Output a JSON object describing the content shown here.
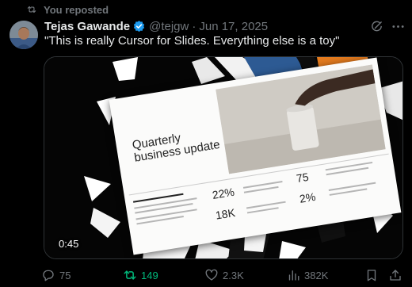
{
  "repost": {
    "label": "You reposted"
  },
  "post": {
    "author_name": "Tejas Gawande",
    "handle": "@tejgw",
    "separator": "·",
    "date": "Jun 17, 2025",
    "text": "\"This is really Cursor for Slides. Everything else is a toy\""
  },
  "media": {
    "duration": "0:45",
    "slide": {
      "title": "Quarterly business update",
      "stats": [
        "22%",
        "18K",
        "75",
        "2%"
      ]
    }
  },
  "actions": {
    "replies": "75",
    "reposts": "149",
    "likes": "2.3K",
    "views": "382K"
  },
  "colors": {
    "background": "#000000",
    "text": "#e7e9ea",
    "muted": "#71767b",
    "verified": "#1d9bf0",
    "repost_active": "#00ba7c",
    "border": "#2f3336"
  },
  "icons": {
    "repost": "repost-icon",
    "verified": "verified-badge-icon",
    "grok": "grok-icon",
    "more": "more-icon",
    "reply": "reply-icon",
    "like": "heart-icon",
    "views": "views-icon",
    "bookmark": "bookmark-icon",
    "share": "share-icon"
  }
}
